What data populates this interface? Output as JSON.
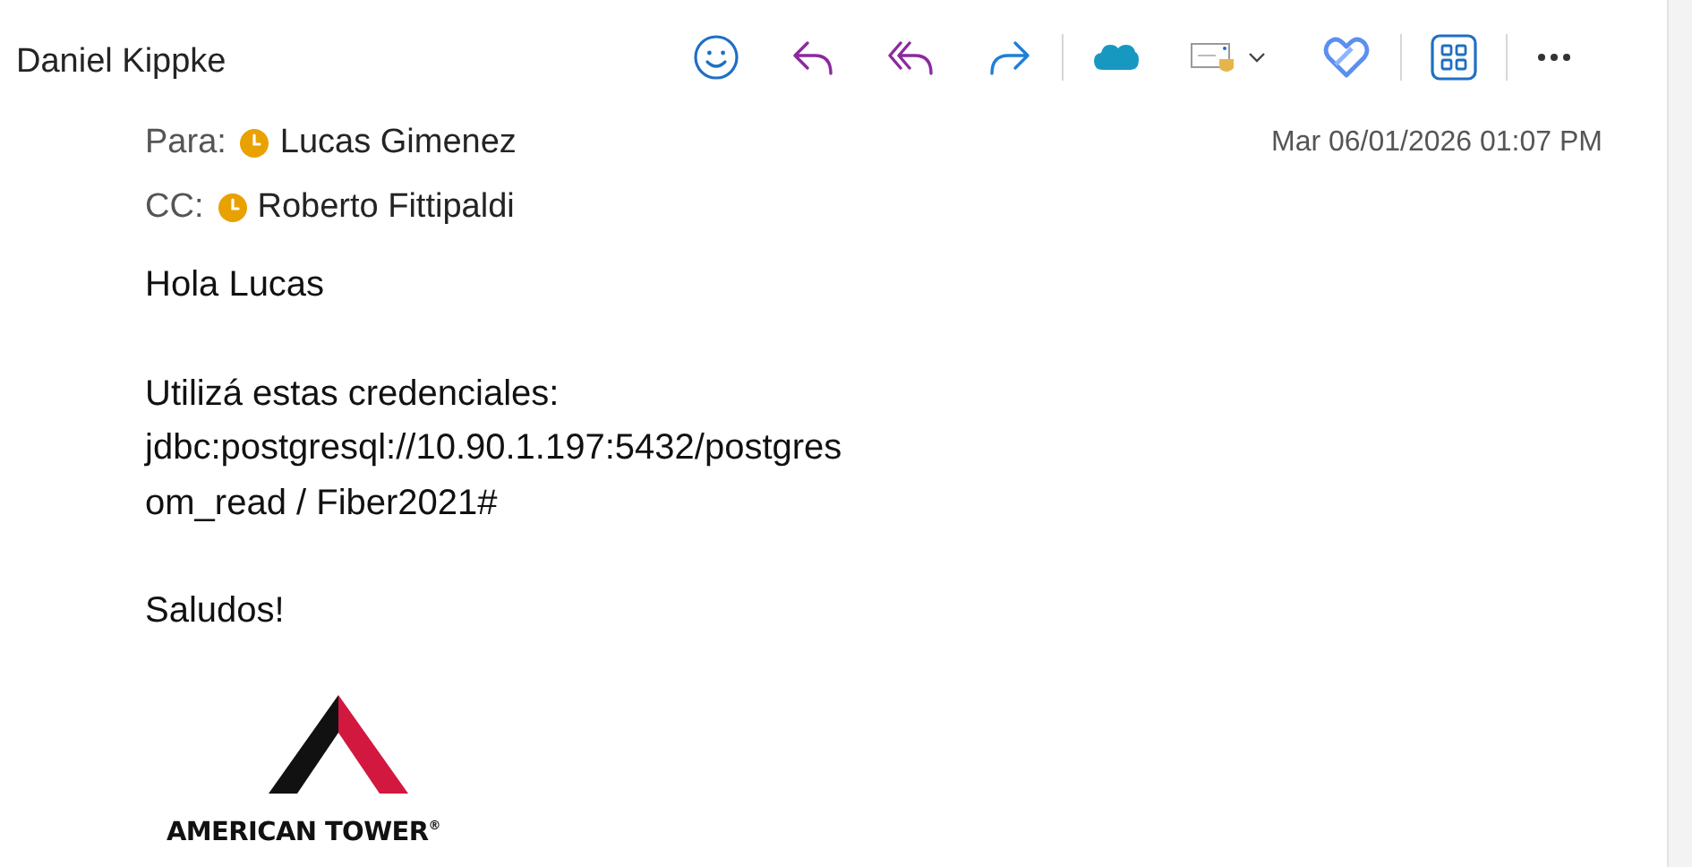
{
  "sender": "Daniel Kippke",
  "toolbar": [
    {
      "kind": "emoji"
    },
    {
      "kind": "reply"
    },
    {
      "kind": "reply-all"
    },
    {
      "kind": "forward"
    },
    {
      "kind": "divider"
    },
    {
      "kind": "cloud"
    },
    {
      "kind": "envelope"
    },
    {
      "kind": "hearts"
    },
    {
      "kind": "divider"
    },
    {
      "kind": "apps"
    },
    {
      "kind": "divider"
    },
    {
      "kind": "more"
    }
  ],
  "recipients": [
    {
      "label": "Para:",
      "name": "Lucas Gimenez"
    },
    {
      "label": "CC:",
      "name": "Roberto Fittipaldi"
    }
  ],
  "date": "Mar 06/01/2026 01:07 PM",
  "body": [
    "Hola Lucas",
    "Utilizá estas credenciales:\njdbc:postgresql://10.90.1.197:5432/postgres\nom_read / Fiber2021#",
    "Saludos!"
  ],
  "signature": {
    "logo_text": "AMERICAN TOWER",
    "mark": "®"
  }
}
